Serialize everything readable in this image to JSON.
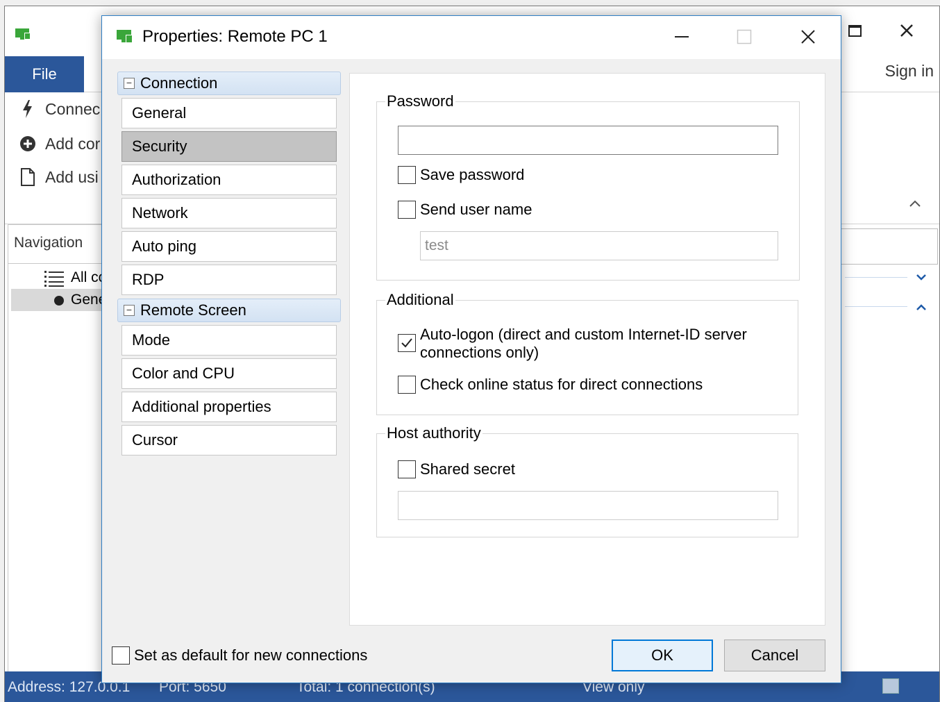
{
  "background_window": {
    "ribbon_tab_file": "File",
    "sign_in": "Sign in",
    "commands": [
      "Connec",
      "Add cor",
      "Add usi"
    ],
    "navigation_header": "Navigation",
    "nav_items": [
      "All cc",
      "Gene"
    ]
  },
  "status_bar": {
    "address": "Address: 127.0.0.1",
    "port": "Port: 5650",
    "total": "Total: 1 connection(s)",
    "mode": "View only"
  },
  "dialog": {
    "title": "Properties: Remote PC 1",
    "tree": {
      "groups": [
        {
          "label": "Connection",
          "expander": "−",
          "items": [
            "General",
            "Security",
            "Authorization",
            "Network",
            "Auto ping",
            "RDP"
          ]
        },
        {
          "label": "Remote Screen",
          "expander": "−",
          "items": [
            "Mode",
            "Color and CPU",
            "Additional properties",
            "Cursor"
          ]
        }
      ],
      "selected_item": "Security"
    },
    "password_group": {
      "title": "Password",
      "password_value": "",
      "save_password_label": "Save password",
      "save_password_checked": false,
      "send_user_name_label": "Send user name",
      "send_user_name_checked": false,
      "user_name_value": "test"
    },
    "additional_group": {
      "title": "Additional",
      "auto_logon_label_line1": "Auto-logon (direct and custom Internet-ID server",
      "auto_logon_label_line2": "connections only)",
      "auto_logon_checked": true,
      "check_online_label": "Check online status for direct connections",
      "check_online_checked": false
    },
    "host_authority_group": {
      "title": "Host authority",
      "shared_secret_label": "Shared secret",
      "shared_secret_checked": false,
      "shared_secret_value": ""
    },
    "set_default_label": "Set as default for new connections",
    "set_default_checked": false,
    "ok_label": "OK",
    "cancel_label": "Cancel"
  },
  "colors": {
    "accent": "#2b579a",
    "dialog_border": "#2f7ec4",
    "app_icon_green": "#3aa63a"
  }
}
